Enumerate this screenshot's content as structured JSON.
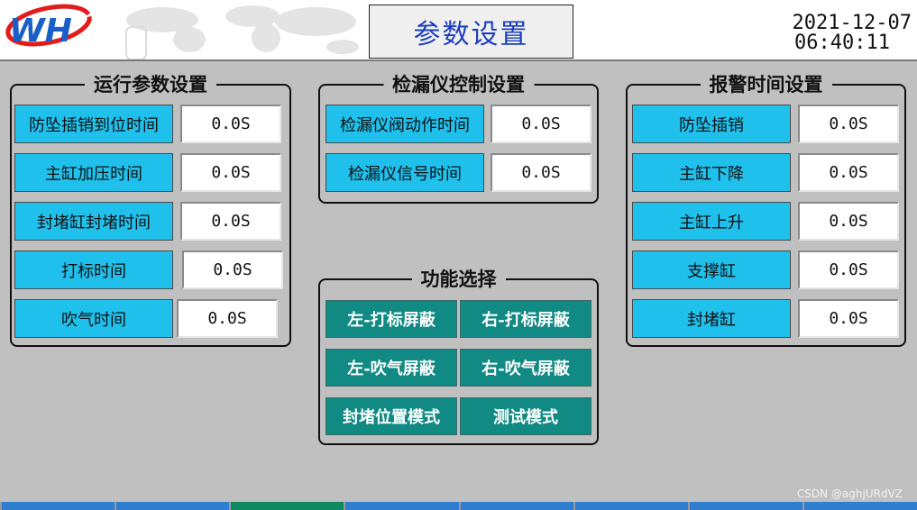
{
  "header": {
    "title": "参数设置",
    "date": "2021-12-07",
    "time": "06:40:11",
    "logo_text": "WH"
  },
  "groups": {
    "run": {
      "title": "运行参数设置",
      "items": [
        {
          "label": "防坠插销到位时间",
          "value": "0.0S"
        },
        {
          "label": "主缸加压时间",
          "value": "0.0S"
        },
        {
          "label": "封堵缸封堵时间",
          "value": "0.0S"
        },
        {
          "label": "打标时间",
          "value": "0.0S"
        },
        {
          "label": "吹气时间",
          "value": "0.0S"
        }
      ]
    },
    "leak": {
      "title": "检漏仪控制设置",
      "items": [
        {
          "label": "检漏仪阀动作时间",
          "value": "0.0S"
        },
        {
          "label": "检漏仪信号时间",
          "value": "0.0S"
        }
      ]
    },
    "alarm": {
      "title": "报警时间设置",
      "items": [
        {
          "label": "防坠插销",
          "value": "0.0S"
        },
        {
          "label": "主缸下降",
          "value": "0.0S"
        },
        {
          "label": "主缸上升",
          "value": "0.0S"
        },
        {
          "label": "支撑缸",
          "value": "0.0S"
        },
        {
          "label": "封堵缸",
          "value": "0.0S"
        }
      ]
    },
    "func": {
      "title": "功能选择",
      "buttons": [
        "左-打标屏蔽",
        "右-打标屏蔽",
        "左-吹气屏蔽",
        "右-吹气屏蔽",
        "封堵位置模式",
        "测试模式"
      ]
    }
  },
  "watermark": "CSDN @aghjURdVZ",
  "colors": {
    "label_bg": "#20c0ec",
    "button_bg": "#108a82",
    "title_text": "#1c3fbf",
    "nav_blue": "#2f7fd0",
    "nav_active": "#108a60"
  }
}
